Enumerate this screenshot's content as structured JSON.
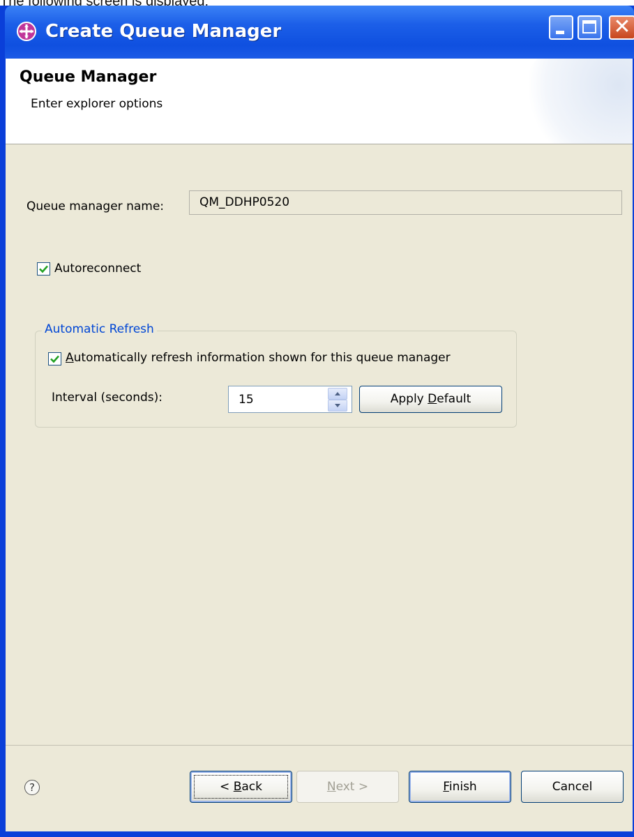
{
  "caption": "The following screen is displayed:",
  "window": {
    "title": "Create Queue Manager",
    "app_icon": "ibm-mq-icon",
    "controls": [
      "minimize-icon",
      "maximize-icon",
      "close-icon"
    ],
    "close_glyph": "✕"
  },
  "header": {
    "title": "Queue Manager",
    "subtitle": "Enter explorer options"
  },
  "form": {
    "queue_manager_label": "Queue manager name:",
    "queue_manager_value": "QM_DDHP0520",
    "autoreconnect": {
      "label": "Autoreconnect",
      "checked": true
    },
    "refresh_group": {
      "title": "Automatic Refresh",
      "auto_refresh_prefix": "A",
      "auto_refresh_rest": "utomatically refresh information shown for this queue manager",
      "auto_refresh_checked": true,
      "interval_label": "Interval (seconds):",
      "interval_value": "15",
      "apply_default_prefix": "Apply ",
      "apply_default_mnemonic": "D",
      "apply_default_rest": "efault"
    }
  },
  "footer": {
    "help_glyph": "?",
    "back": {
      "prefix": "< ",
      "mnemonic": "B",
      "rest": "ack"
    },
    "next": {
      "mnemonic": "N",
      "rest": "ext >",
      "enabled": false
    },
    "finish": {
      "mnemonic": "F",
      "rest": "inish"
    },
    "cancel": {
      "label": "Cancel"
    }
  },
  "colors": {
    "title_bar": "#1c5fe8",
    "dialog_bg": "#ece9d8",
    "group_title": "#0046d5",
    "checkmark": "#21a121"
  }
}
